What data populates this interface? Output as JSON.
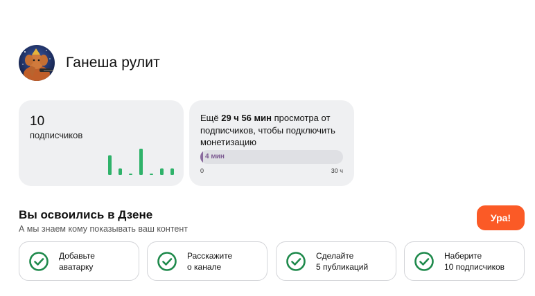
{
  "channel": {
    "name": "Ганеша рулит",
    "avatar": "ganesha-avatar"
  },
  "subscribers": {
    "count": "10",
    "label": "подписчиков",
    "sparkline": [
      3,
      1,
      0.2,
      4,
      0.2,
      1,
      1
    ],
    "sparkline_color": "#2fb26a"
  },
  "monetization": {
    "prefix": "Ещё ",
    "hours": "29 ч 56 мин",
    "suffix": " просмотра от подписчиков, чтобы подключить монетизацию",
    "progress_label": "4 мин",
    "progress_fraction": 0.0022,
    "scale_min": "0",
    "scale_max": "30 ч",
    "progress_color": "#8a6a9e"
  },
  "onboarding": {
    "title": "Вы освоились в Дзене",
    "subtitle": "А мы знаем кому показывать ваш контент",
    "button": "Ура!",
    "button_color": "#fb5a26",
    "check_color": "#1f8a4c",
    "tasks": [
      {
        "label": "Добавьте\nаватарку",
        "icon": "check-circle-icon"
      },
      {
        "label": "Расскажите\nо канале",
        "icon": "check-circle-icon"
      },
      {
        "label": "Сделайте\n5 публикаций",
        "icon": "check-circle-icon"
      },
      {
        "label": "Наберите\n10 подписчиков",
        "icon": "check-circle-icon"
      }
    ]
  }
}
